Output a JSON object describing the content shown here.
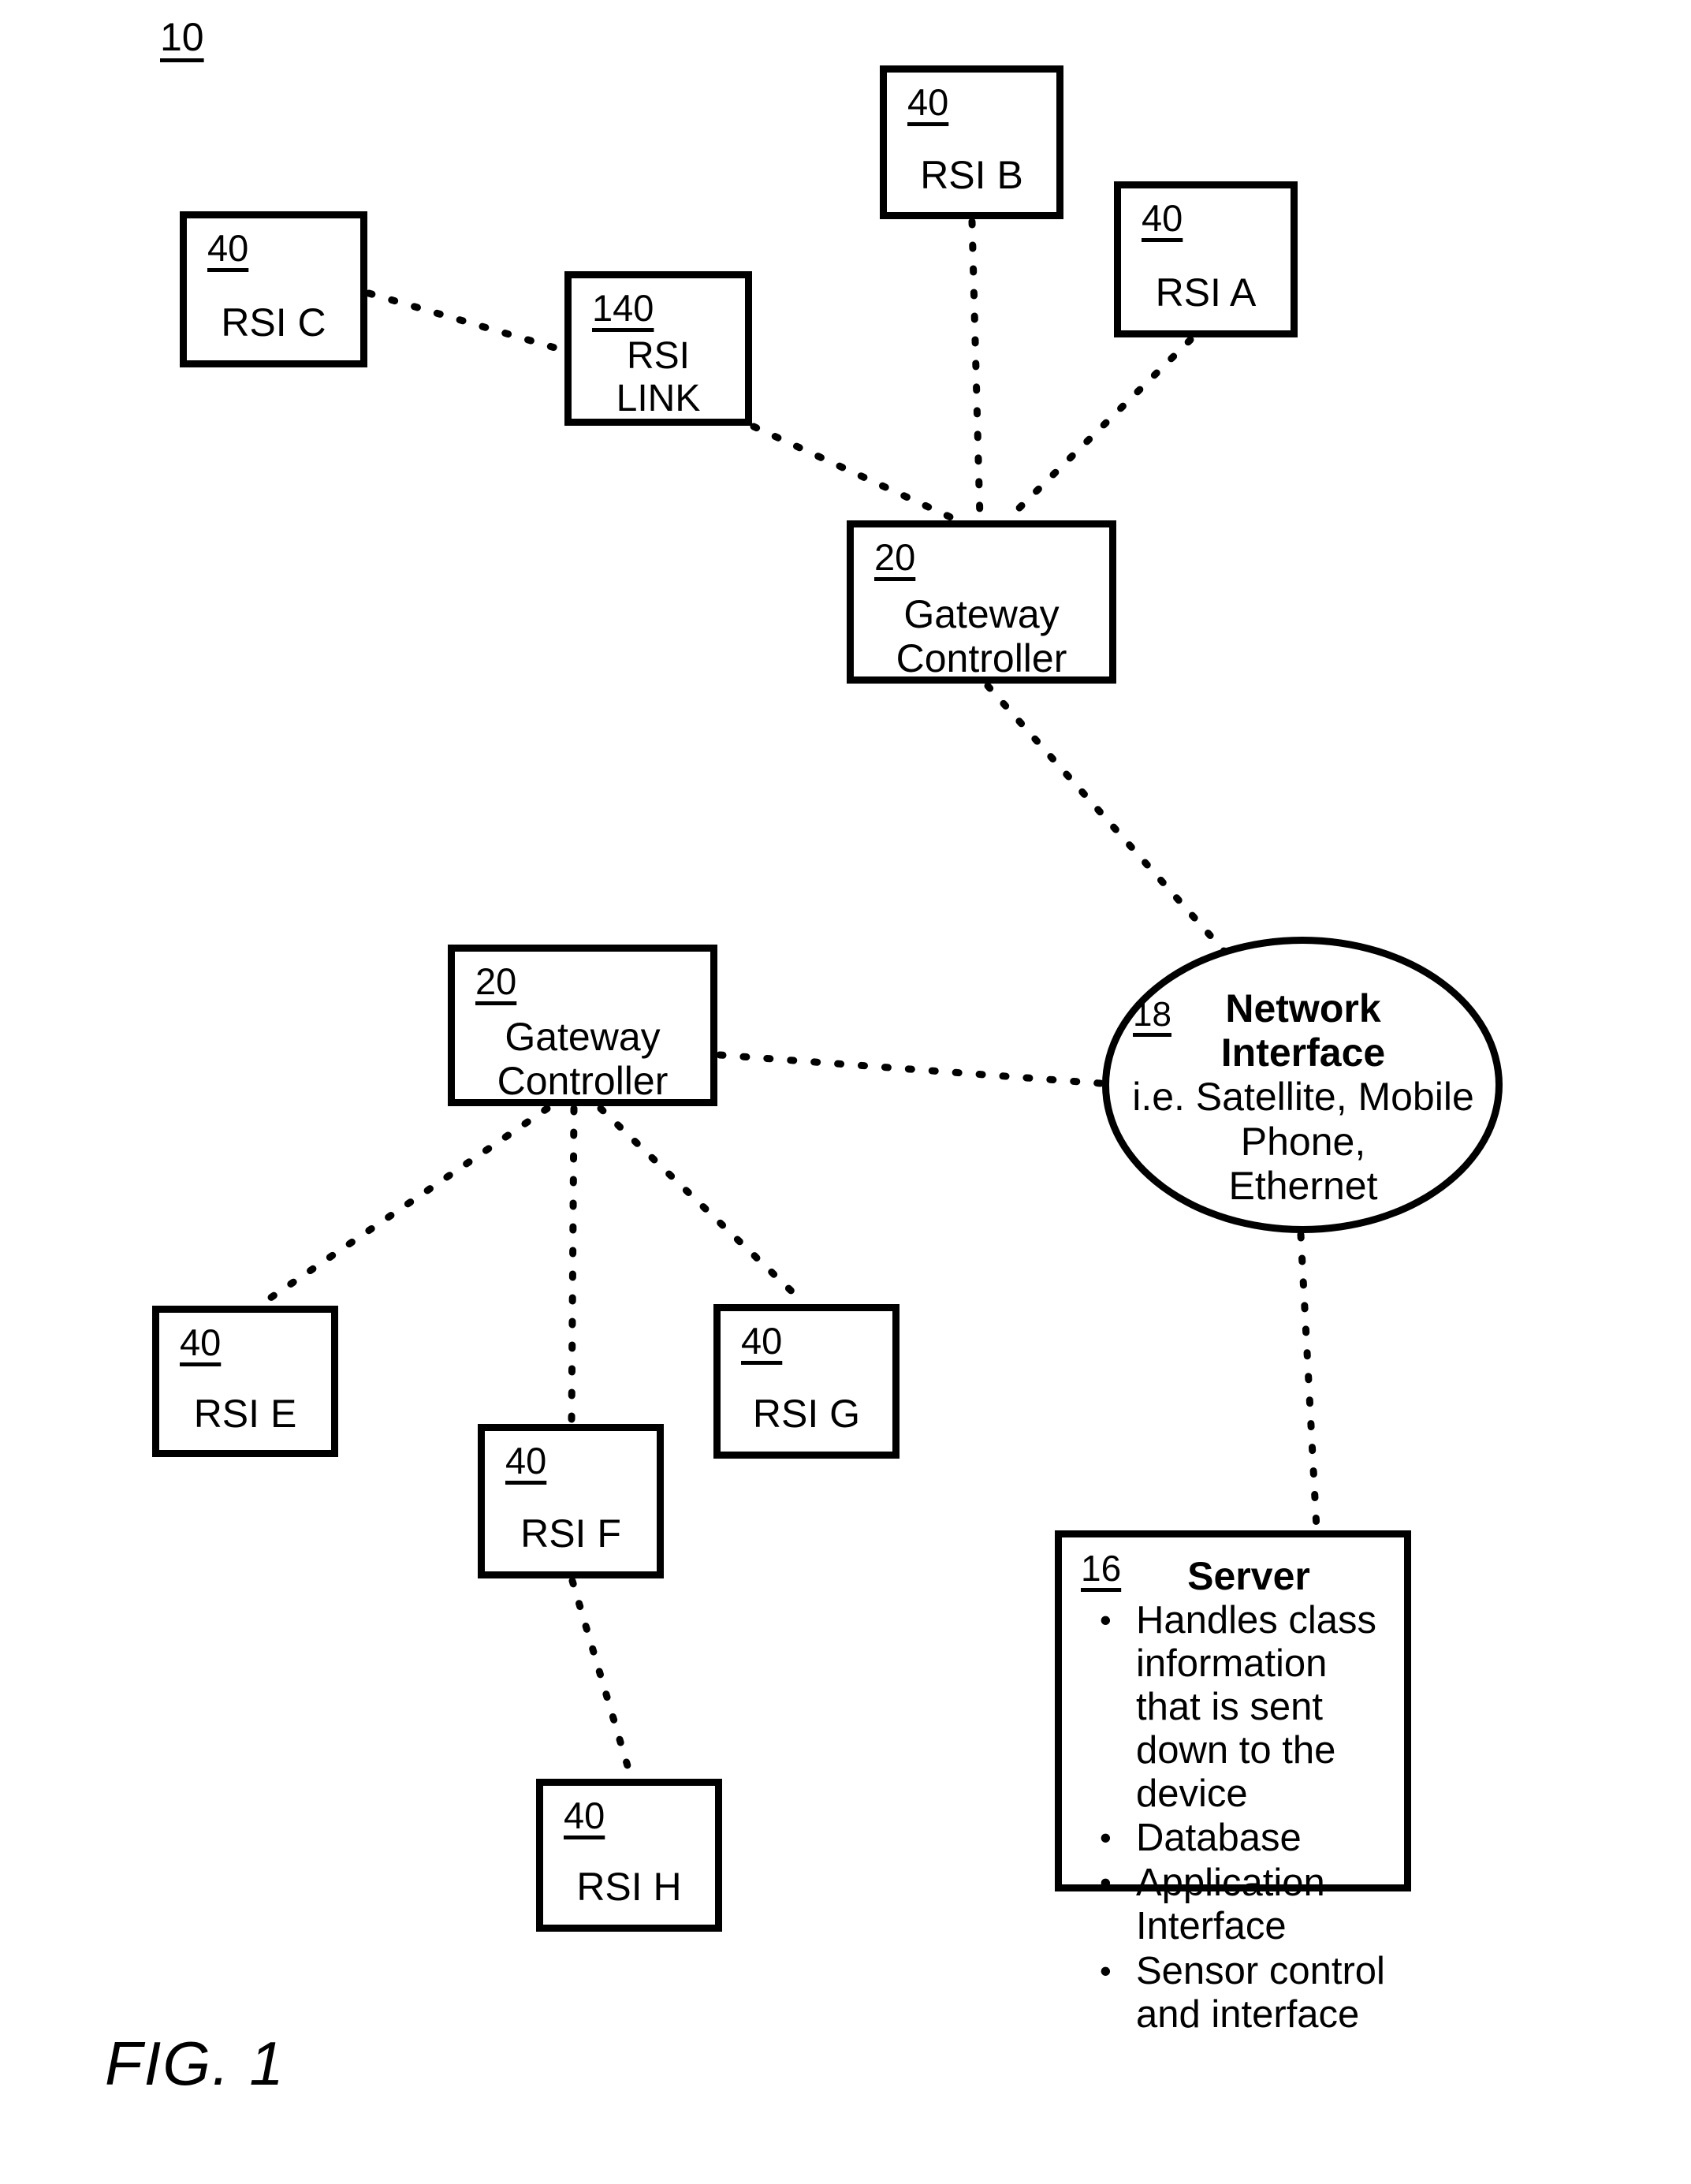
{
  "figure": {
    "number_label": "10",
    "caption": "FIG. 1"
  },
  "nodes": {
    "rsi_c": {
      "ref": "40",
      "label": "RSI C"
    },
    "rsi_link": {
      "ref": "140",
      "label": "RSI\nLINK"
    },
    "rsi_b": {
      "ref": "40",
      "label": "RSI B"
    },
    "rsi_a": {
      "ref": "40",
      "label": "RSI A"
    },
    "gateway_top": {
      "ref": "20",
      "label": "Gateway\nController"
    },
    "gateway_bottom": {
      "ref": "20",
      "label": "Gateway\nController"
    },
    "network_interface": {
      "ref": "18",
      "title": "Network\nInterface",
      "subtitle": "i.e. Satellite, Mobile\nPhone,\nEthernet"
    },
    "server": {
      "ref": "16",
      "title": "Server",
      "bullets": [
        "Handles class information that is sent down to the device",
        "Database",
        "Application Interface",
        "Sensor control and interface"
      ]
    },
    "rsi_e": {
      "ref": "40",
      "label": "RSI E"
    },
    "rsi_f": {
      "ref": "40",
      "label": "RSI F"
    },
    "rsi_g": {
      "ref": "40",
      "label": "RSI G"
    },
    "rsi_h": {
      "ref": "40",
      "label": "RSI H"
    }
  },
  "connections": [
    {
      "from": "rsi_c",
      "to": "rsi_link",
      "style": "dashed"
    },
    {
      "from": "rsi_link",
      "to": "gateway_top",
      "style": "dashed"
    },
    {
      "from": "rsi_b",
      "to": "gateway_top",
      "style": "dashed"
    },
    {
      "from": "rsi_a",
      "to": "gateway_top",
      "style": "dashed"
    },
    {
      "from": "gateway_top",
      "to": "network_interface",
      "style": "dashed"
    },
    {
      "from": "gateway_bottom",
      "to": "network_interface",
      "style": "dashed"
    },
    {
      "from": "network_interface",
      "to": "server",
      "style": "dashed"
    },
    {
      "from": "gateway_bottom",
      "to": "rsi_e",
      "style": "dashed"
    },
    {
      "from": "gateway_bottom",
      "to": "rsi_f",
      "style": "dashed"
    },
    {
      "from": "gateway_bottom",
      "to": "rsi_g",
      "style": "dashed"
    },
    {
      "from": "rsi_f",
      "to": "rsi_h",
      "style": "dashed"
    }
  ],
  "colors": {
    "stroke": "#000000",
    "background": "#ffffff"
  }
}
